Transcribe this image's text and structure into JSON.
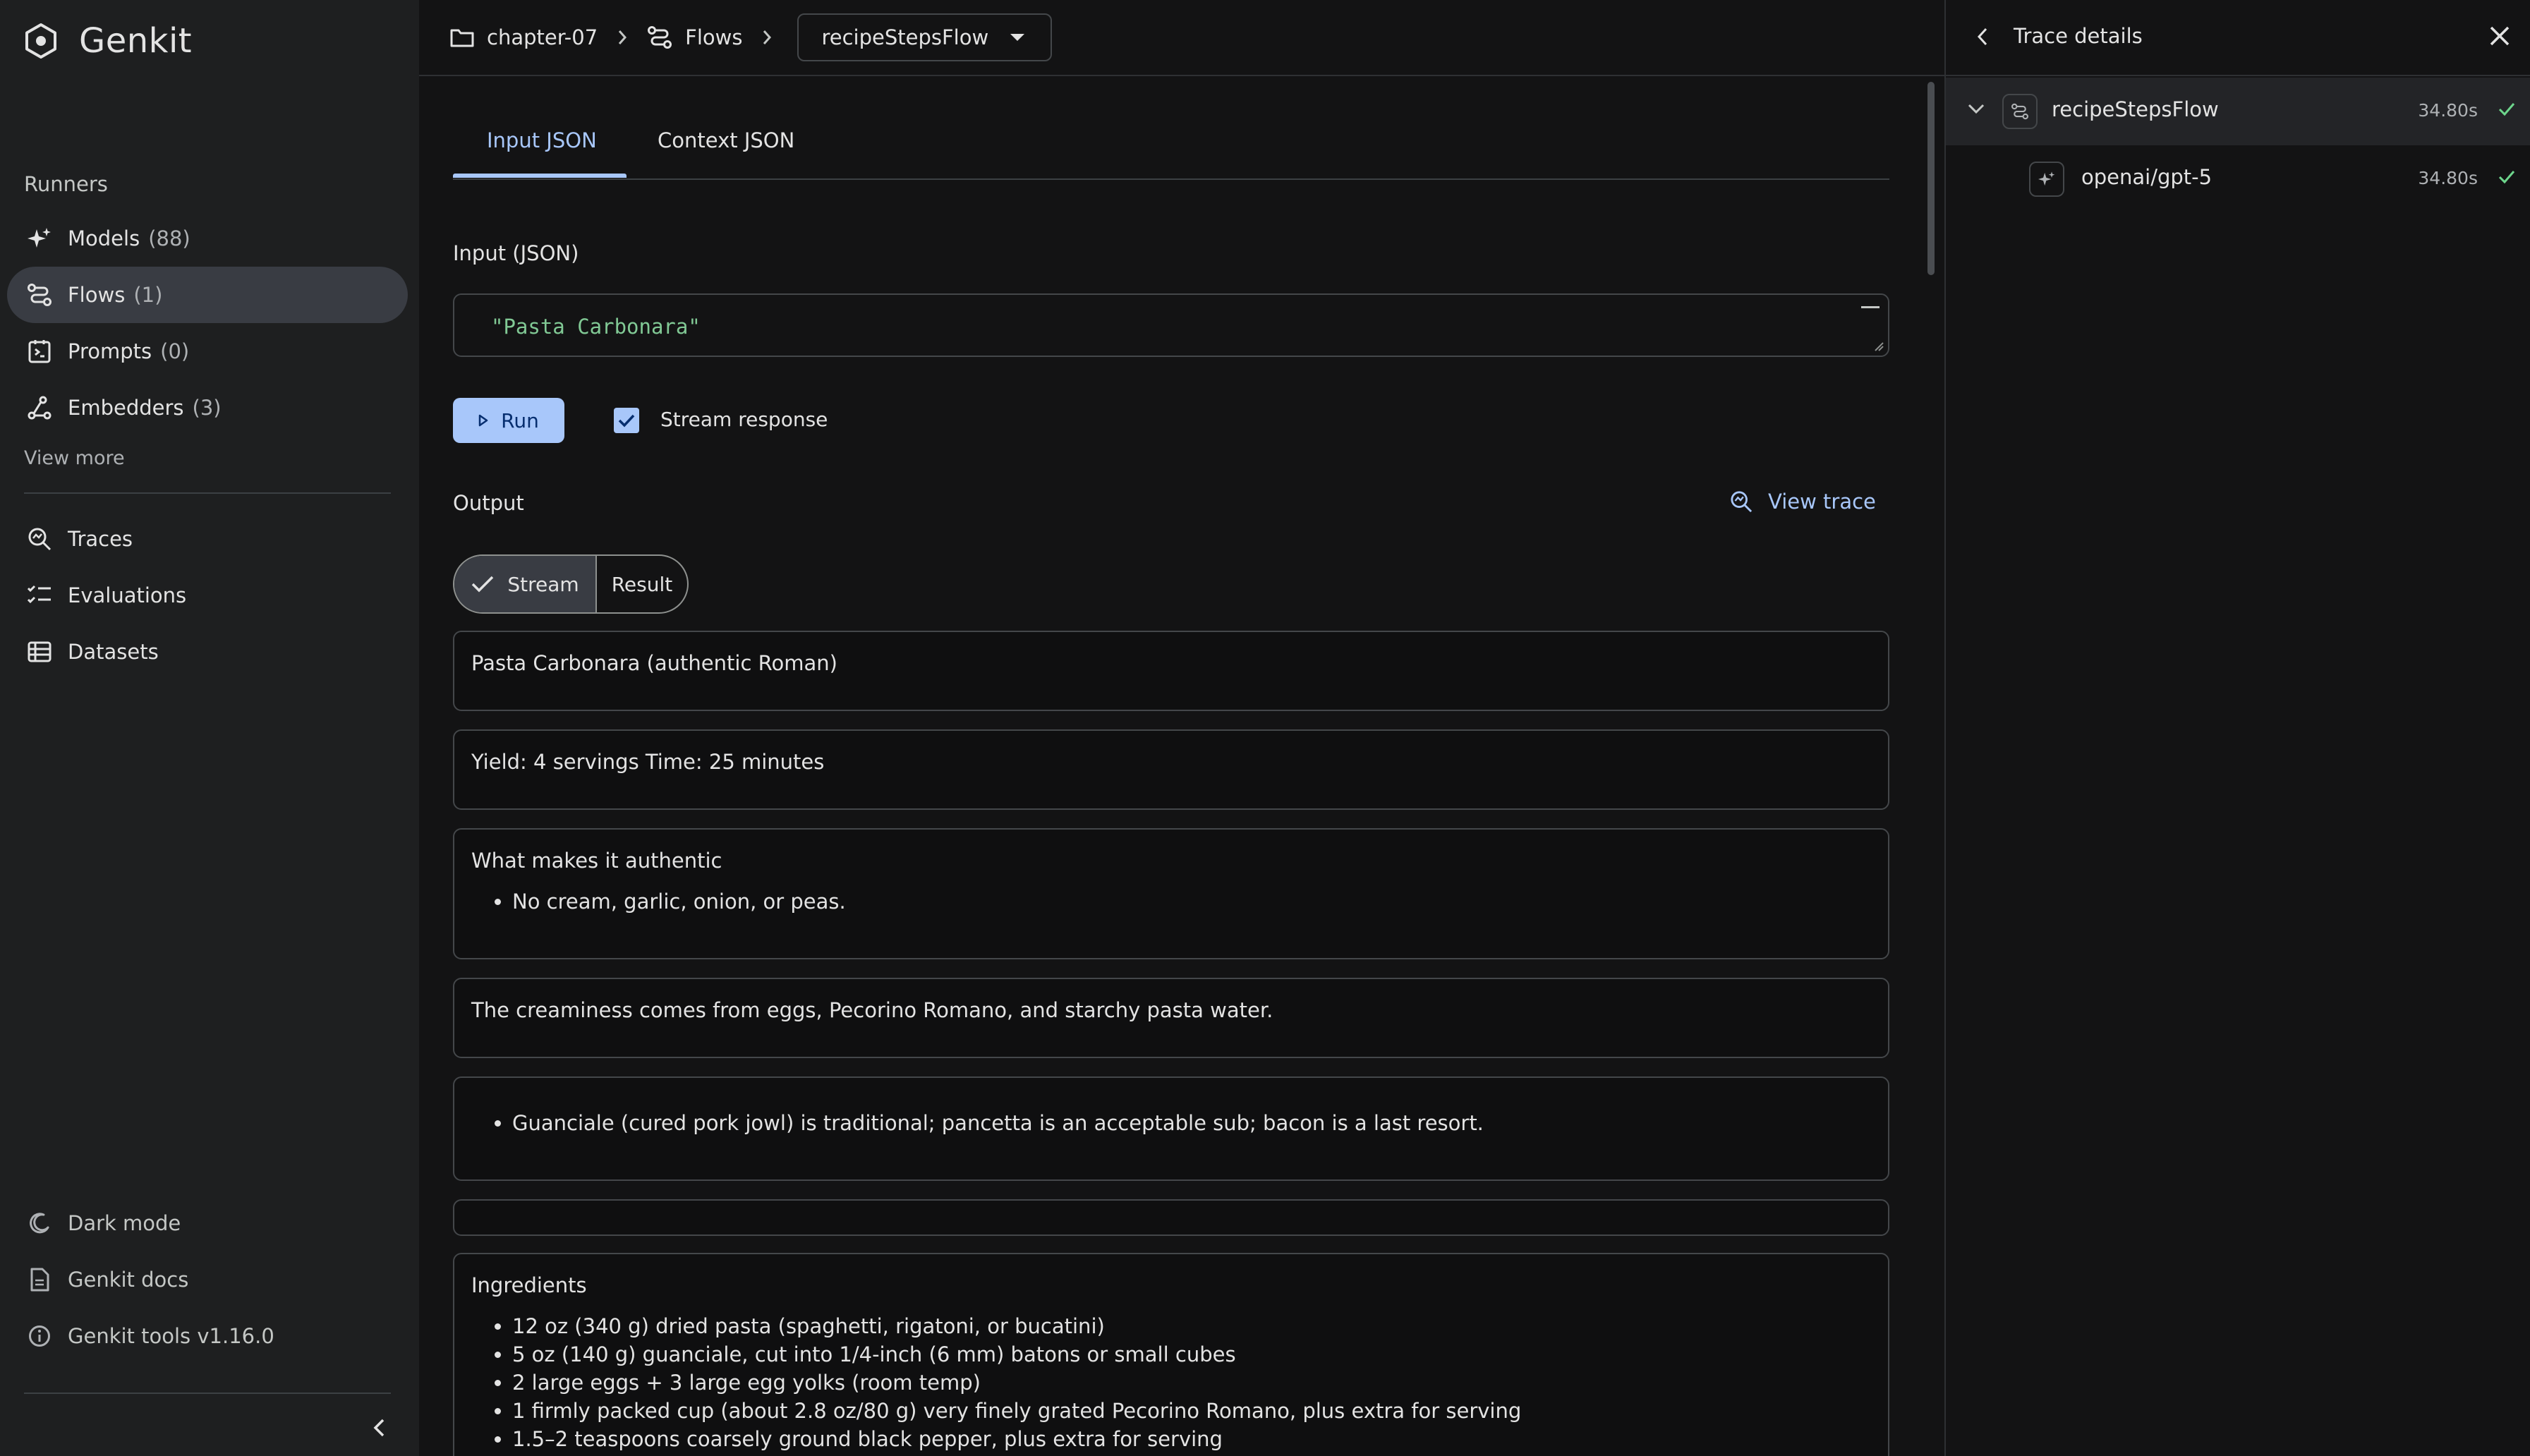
{
  "brand": {
    "name": "Genkit"
  },
  "sidebar": {
    "section_label": "Runners",
    "runners": [
      {
        "label": "Models",
        "count": "(88)",
        "icon": "sparkle-icon"
      },
      {
        "label": "Flows",
        "count": "(1)",
        "icon": "flow-icon",
        "active": true
      },
      {
        "label": "Prompts",
        "count": "(0)",
        "icon": "prompt-icon"
      },
      {
        "label": "Embedders",
        "count": "(3)",
        "icon": "embedder-icon"
      }
    ],
    "view_more": "View more",
    "tools": [
      {
        "label": "Traces",
        "icon": "trace-search-icon"
      },
      {
        "label": "Evaluations",
        "icon": "checklist-icon"
      },
      {
        "label": "Datasets",
        "icon": "dataset-icon"
      }
    ],
    "footer": [
      {
        "label": "Dark mode",
        "icon": "moon-icon"
      },
      {
        "label": "Genkit docs",
        "icon": "document-icon"
      },
      {
        "label": "Genkit tools v1.16.0",
        "icon": "info-icon"
      }
    ]
  },
  "breadcrumb": {
    "project": "chapter-07",
    "section": "Flows",
    "selected_flow": "recipeStepsFlow"
  },
  "tabs": [
    {
      "label": "Input JSON",
      "active": true
    },
    {
      "label": "Context JSON",
      "active": false
    }
  ],
  "input": {
    "label": "Input (JSON)",
    "value": "\"Pasta Carbonara\""
  },
  "actions": {
    "run_label": "Run",
    "stream_checkbox_label": "Stream response",
    "stream_checked": true
  },
  "output": {
    "label": "Output",
    "view_trace": "View trace",
    "toggle": {
      "stream": "Stream",
      "result": "Result",
      "selected": "Stream"
    },
    "chunks": [
      {
        "text": "Pasta Carbonara (authentic Roman)",
        "bullets": []
      },
      {
        "text": "Yield: 4 servings Time: 25 minutes",
        "bullets": []
      },
      {
        "text": "What makes it authentic",
        "bullets": [
          "No cream, garlic, onion, or peas."
        ]
      },
      {
        "text": "The creaminess comes from eggs, Pecorino Romano, and starchy pasta water.",
        "bullets": []
      },
      {
        "text": "",
        "bullets": [
          "Guanciale (cured pork jowl) is traditional; pancetta is an acceptable sub; bacon is a last resort."
        ]
      },
      {
        "text": "",
        "bullets": []
      },
      {
        "text": "Ingredients",
        "bullets": [
          "12 oz (340 g) dried pasta (spaghetti, rigatoni, or bucatini)",
          "5 oz (140 g) guanciale, cut into 1/4-inch (6 mm) batons or small cubes",
          "2 large eggs + 3 large egg yolks (room temp)",
          "1 firmly packed cup (about 2.8 oz/80 g) very finely grated Pecorino Romano, plus extra for serving",
          "1.5–2 teaspoons coarsely ground black pepper, plus extra for serving"
        ]
      }
    ]
  },
  "trace": {
    "title": "Trace details",
    "spans": [
      {
        "name": "recipeStepsFlow",
        "duration": "34.80s",
        "status": "success",
        "icon": "flow-icon"
      },
      {
        "name": "openai/gpt-5",
        "duration": "34.80s",
        "status": "success",
        "icon": "sparkle-icon"
      }
    ],
    "success_color": "#6dd58c"
  },
  "colors": {
    "accent": "#a8c7fa",
    "json_string": "#81c995"
  }
}
